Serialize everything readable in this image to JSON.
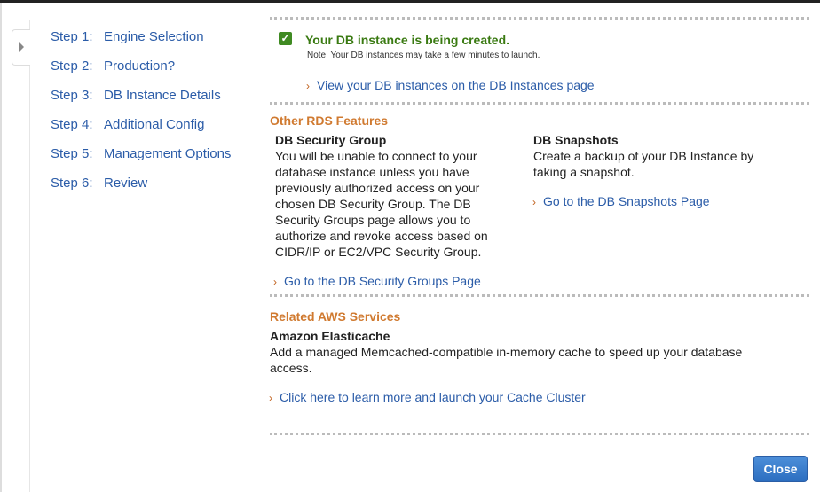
{
  "sidebar": {
    "steps": [
      {
        "num": "Step 1:",
        "label": "Engine Selection"
      },
      {
        "num": "Step 2:",
        "label": "Production?"
      },
      {
        "num": "Step 3:",
        "label": "DB Instance Details"
      },
      {
        "num": "Step 4:",
        "label": "Additional Config"
      },
      {
        "num": "Step 5:",
        "label": "Management Options"
      },
      {
        "num": "Step 6:",
        "label": "Review"
      }
    ]
  },
  "status": {
    "title": "Your DB instance is being created.",
    "note": "Note: Your DB instances may take a few minutes to launch.",
    "link": "View your DB instances on the DB Instances page"
  },
  "rds": {
    "heading": "Other RDS Features",
    "security": {
      "title": "DB Security Group",
      "lines": [
        "You will be unable to connect to your",
        "database instance unless you have",
        "previously authorized access on your",
        "chosen DB Security Group. The DB",
        "Security Groups page allows you to",
        "authorize and revoke access based on",
        "CIDR/IP or EC2/VPC Security Group."
      ],
      "link": "Go to the DB Security Groups Page"
    },
    "snapshots": {
      "title": "DB Snapshots",
      "lines": [
        "Create a backup of your DB Instance by",
        "taking a snapshot."
      ],
      "link": "Go to the DB Snapshots Page"
    }
  },
  "related": {
    "heading": "Related AWS Services",
    "title": "Amazon Elasticache",
    "lines": [
      "Add a managed Memcached-compatible in-memory cache to speed up your database",
      "access."
    ],
    "link": "Click here to learn more and launch your Cache Cluster"
  },
  "chevron": "›",
  "checkmark": "✓",
  "close_label": "Close"
}
